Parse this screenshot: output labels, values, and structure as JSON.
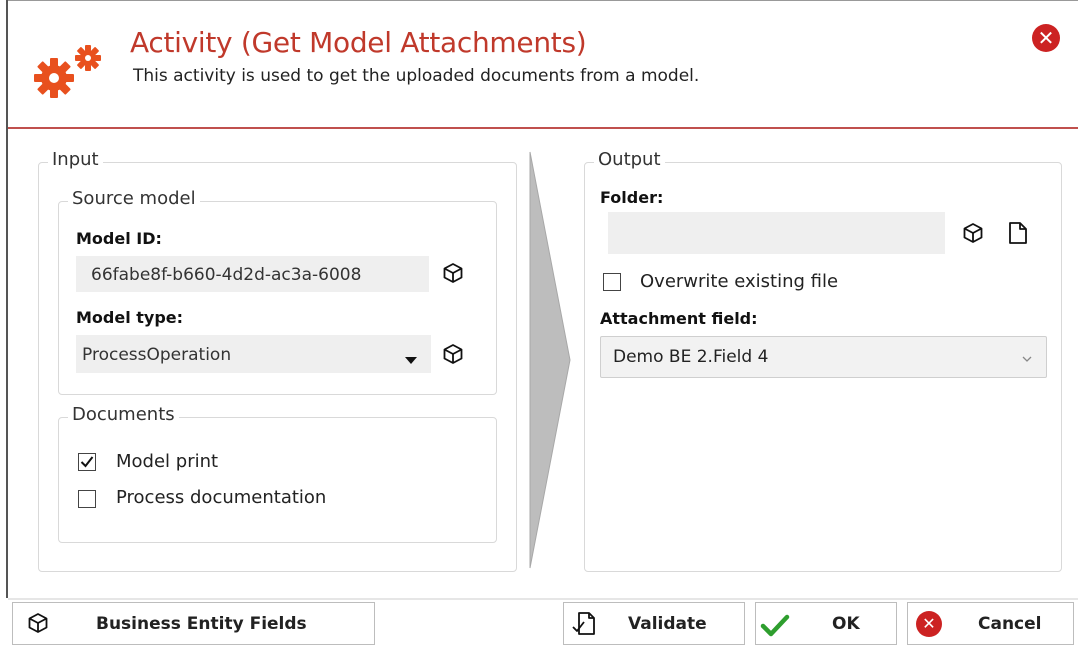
{
  "dialog": {
    "title": "Activity (Get Model Attachments)",
    "subtitle": "This activity is used to get the uploaded documents from a model.",
    "accent_color": "#c0392b"
  },
  "input": {
    "legend": "Input",
    "source_model": {
      "legend": "Source model",
      "model_id_label": "Model ID:",
      "model_id_value": "66fabe8f-b660-4d2d-ac3a-6008",
      "model_type_label": "Model type:",
      "model_type_value": "ProcessOperation"
    },
    "documents": {
      "legend": "Documents",
      "model_print_label": "Model print",
      "model_print_checked": true,
      "process_doc_label": "Process documentation",
      "process_doc_checked": false
    }
  },
  "output": {
    "legend": "Output",
    "folder_label": "Folder:",
    "folder_value": "",
    "overwrite_label": "Overwrite existing file",
    "overwrite_checked": false,
    "attachment_label": "Attachment field:",
    "attachment_value": "Demo BE 2.Field 4"
  },
  "footer": {
    "business_entity_label": "Business Entity Fields",
    "validate_label": "Validate",
    "ok_label": "OK",
    "cancel_label": "Cancel"
  },
  "icons": {
    "header": "gears-icon",
    "close": "close-icon",
    "model": "cube-icon",
    "file": "file-icon",
    "dropdown": "caret-down-icon",
    "check": "checkmark-icon"
  }
}
